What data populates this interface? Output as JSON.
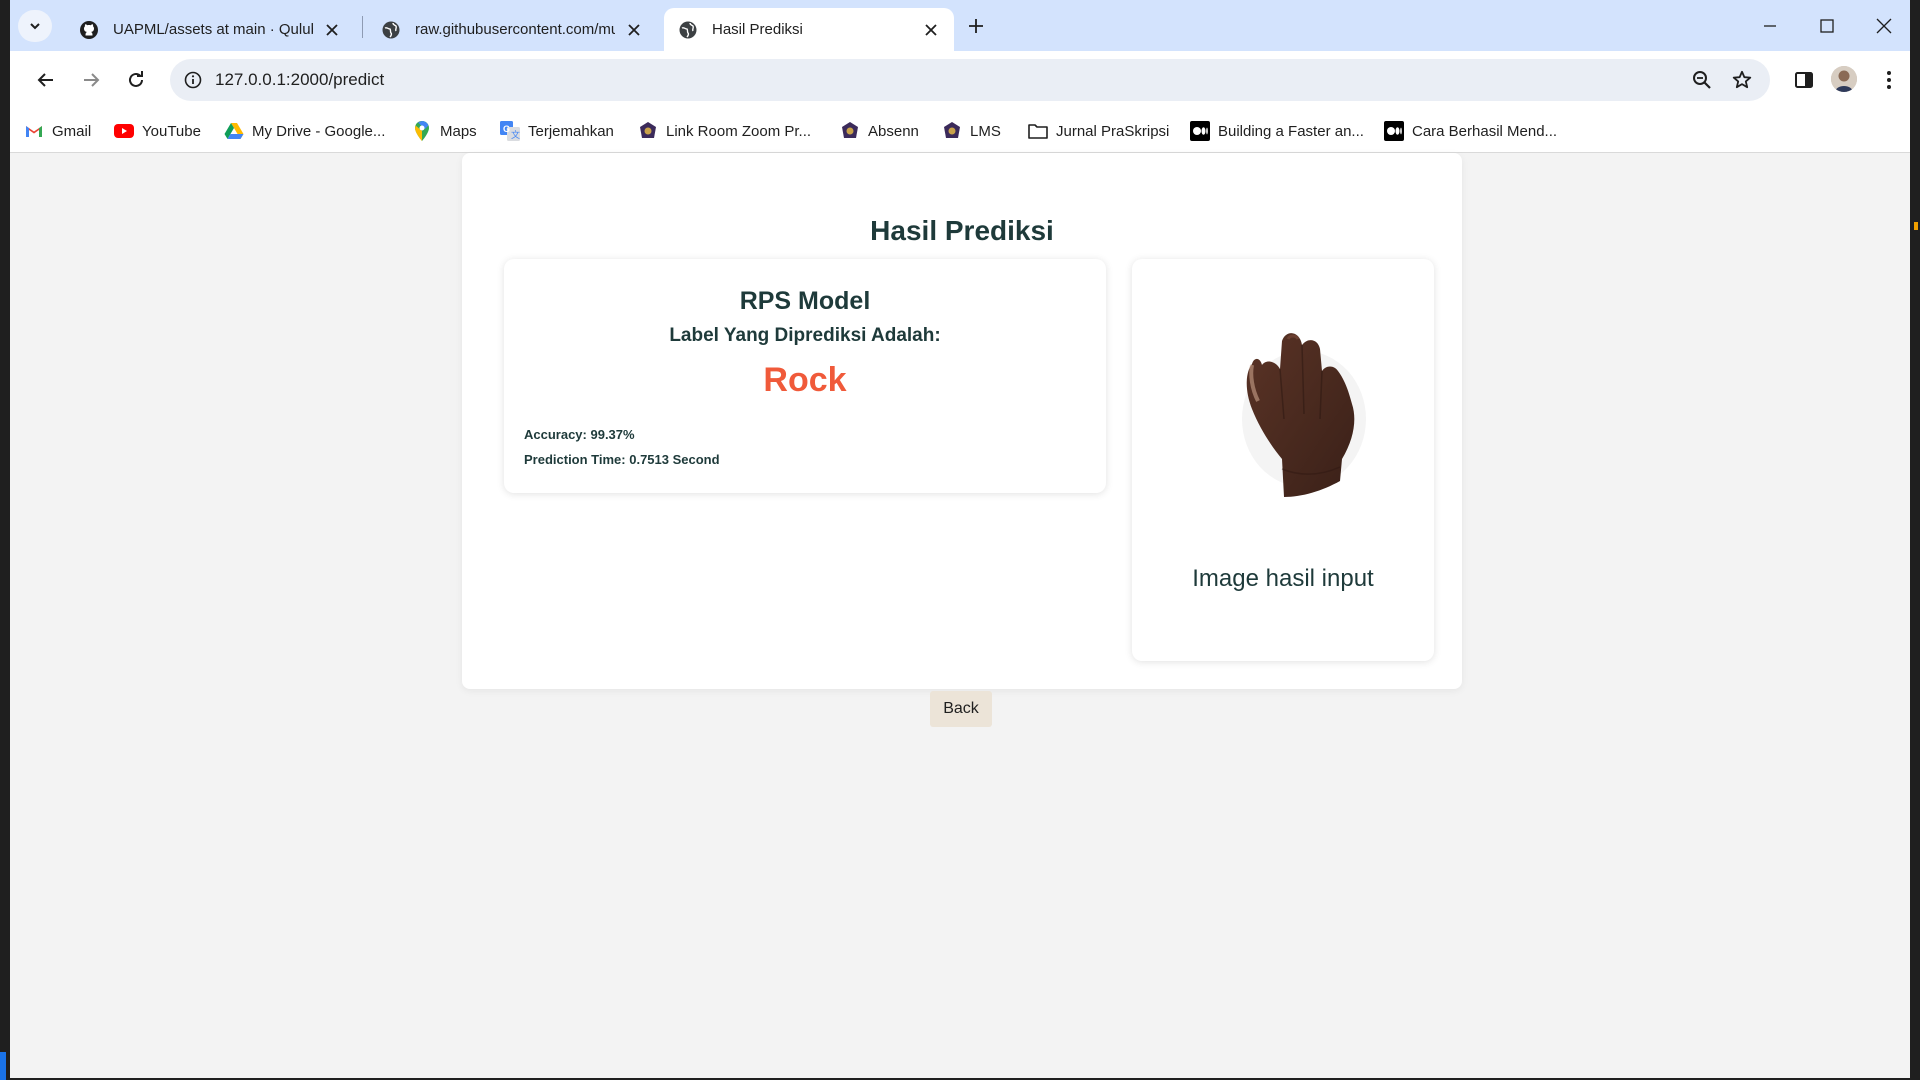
{
  "browser": {
    "tabs": [
      {
        "title": "UAPML/assets at main · Qulubil",
        "icon": "github-icon",
        "active": false
      },
      {
        "title": "raw.githubusercontent.com/mu",
        "icon": "globe-icon",
        "active": false
      },
      {
        "title": "Hasil Prediksi",
        "icon": "globe-icon",
        "active": true
      }
    ],
    "url": "127.0.0.1:2000/predict",
    "bookmarks": [
      {
        "label": "Gmail",
        "icon": "gmail-icon"
      },
      {
        "label": "YouTube",
        "icon": "youtube-icon"
      },
      {
        "label": "My Drive - Google...",
        "icon": "google-drive-icon"
      },
      {
        "label": "Maps",
        "icon": "maps-icon"
      },
      {
        "label": "Terjemahkan",
        "icon": "translate-icon"
      },
      {
        "label": "Link Room Zoom Pr...",
        "icon": "university-icon"
      },
      {
        "label": "Absenn",
        "icon": "university-icon"
      },
      {
        "label": "LMS",
        "icon": "university-icon"
      },
      {
        "label": "Jurnal PraSkripsi",
        "icon": "folder-icon"
      },
      {
        "label": "Building a Faster an...",
        "icon": "medium-icon"
      },
      {
        "label": "Cara Berhasil Mend...",
        "icon": "medium-icon"
      }
    ]
  },
  "page": {
    "title": "Hasil Prediksi",
    "model_name": "RPS Model",
    "label_question": "Label Yang Diprediksi Adalah:",
    "predicted_label": "Rock",
    "accuracy": "Accuracy: 99.37%",
    "prediction_time": "Prediction Time: 0.7513 Second",
    "image_caption": "Image hasil input",
    "back_label": "Back",
    "colors": {
      "heading": "#1e3a3a",
      "prediction": "#f05a3a",
      "background": "#f3f3f3",
      "back_button": "#ece4d8"
    }
  }
}
